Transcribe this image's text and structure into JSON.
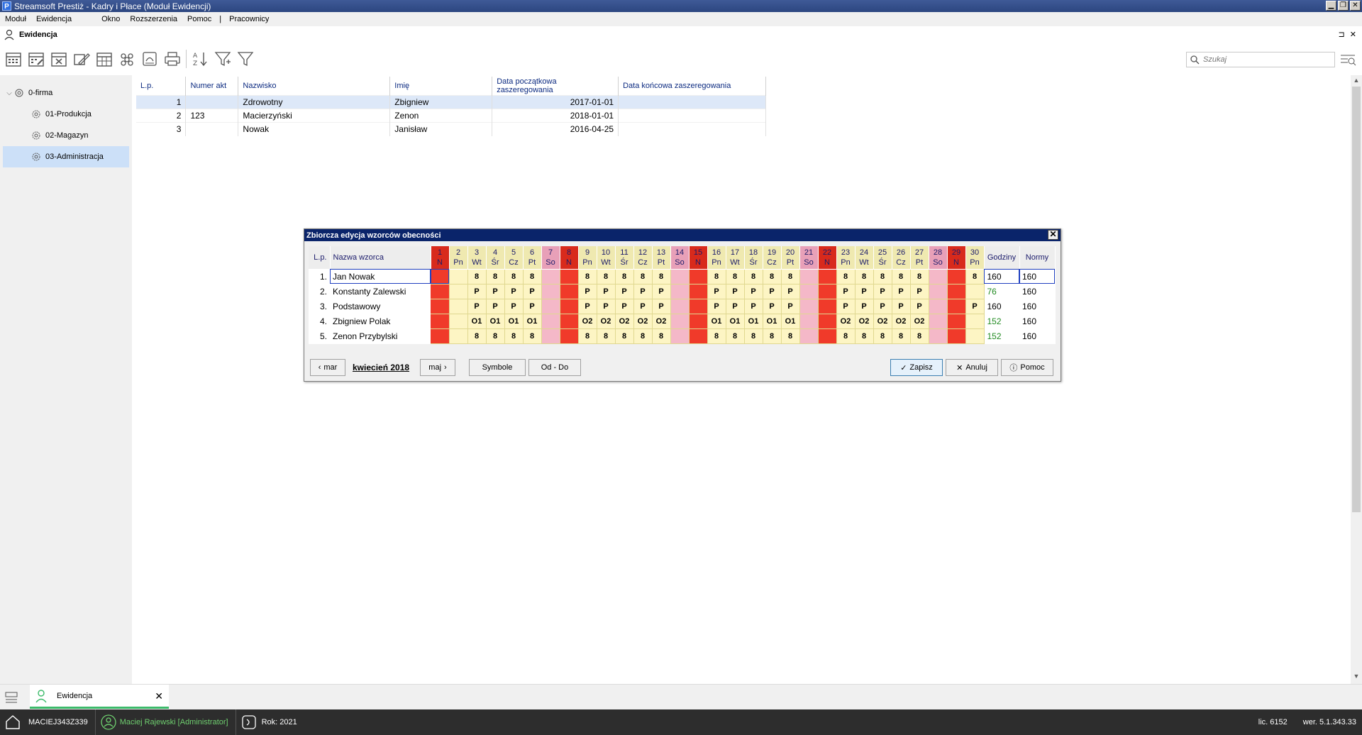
{
  "window": {
    "title": "Streamsoft Prestiż - Kadry i Płace (Moduł Ewidencji)",
    "app_letter": "P"
  },
  "menu": [
    "Moduł",
    "Ewidencja",
    "Okno",
    "Rozszerzenia",
    "Pomoc",
    "|",
    "Pracownicy"
  ],
  "doc_header": {
    "title": "Ewidencja",
    "controls": "⊐ ✕"
  },
  "search": {
    "placeholder": "Szukaj"
  },
  "tree": {
    "root": "0-firma",
    "items": [
      "01-Produkcja",
      "02-Magazyn",
      "03-Administracja"
    ]
  },
  "main_table": {
    "columns": [
      "L.p.",
      "Numer akt",
      "Nazwisko",
      "Imię",
      "Data początkowa zaszeregowania",
      "Data końcowa zaszeregowania"
    ],
    "rows": [
      {
        "lp": "1",
        "numer": "",
        "nazwisko": "Zdrowotny",
        "imie": "Zbigniew",
        "od": "2017-01-01",
        "do": ""
      },
      {
        "lp": "2",
        "numer": "123",
        "nazwisko": "Macierzyński",
        "imie": "Zenon",
        "od": "2018-01-01",
        "do": ""
      },
      {
        "lp": "3",
        "numer": "",
        "nazwisko": "Nowak",
        "imie": "Janisław",
        "od": "2016-04-25",
        "do": ""
      }
    ]
  },
  "dialog": {
    "title": "Zbiorcza edycja wzorców obecności",
    "headers": {
      "lp": "L.p.",
      "name": "Nazwa wzorca",
      "hours": "Godziny",
      "norms": "Normy"
    },
    "days": [
      {
        "n": "1",
        "d": "N"
      },
      {
        "n": "2",
        "d": "Pn"
      },
      {
        "n": "3",
        "d": "Wt"
      },
      {
        "n": "4",
        "d": "Śr"
      },
      {
        "n": "5",
        "d": "Cz"
      },
      {
        "n": "6",
        "d": "Pt"
      },
      {
        "n": "7",
        "d": "So"
      },
      {
        "n": "8",
        "d": "N"
      },
      {
        "n": "9",
        "d": "Pn"
      },
      {
        "n": "10",
        "d": "Wt"
      },
      {
        "n": "11",
        "d": "Śr"
      },
      {
        "n": "12",
        "d": "Cz"
      },
      {
        "n": "13",
        "d": "Pt"
      },
      {
        "n": "14",
        "d": "So"
      },
      {
        "n": "15",
        "d": "N"
      },
      {
        "n": "16",
        "d": "Pn"
      },
      {
        "n": "17",
        "d": "Wt"
      },
      {
        "n": "18",
        "d": "Śr"
      },
      {
        "n": "19",
        "d": "Cz"
      },
      {
        "n": "20",
        "d": "Pt"
      },
      {
        "n": "21",
        "d": "So"
      },
      {
        "n": "22",
        "d": "N"
      },
      {
        "n": "23",
        "d": "Pn"
      },
      {
        "n": "24",
        "d": "Wt"
      },
      {
        "n": "25",
        "d": "Śr"
      },
      {
        "n": "26",
        "d": "Cz"
      },
      {
        "n": "27",
        "d": "Pt"
      },
      {
        "n": "28",
        "d": "So"
      },
      {
        "n": "29",
        "d": "N"
      },
      {
        "n": "30",
        "d": "Pn"
      }
    ],
    "day_types": [
      "sun",
      "work",
      "work",
      "work",
      "work",
      "work",
      "sat",
      "sun",
      "work",
      "work",
      "work",
      "work",
      "work",
      "sat",
      "sun",
      "work",
      "work",
      "work",
      "work",
      "work",
      "sat",
      "sun",
      "work",
      "work",
      "work",
      "work",
      "work",
      "sat",
      "sun",
      "work"
    ],
    "rows": [
      {
        "lp": "1.",
        "name": "Jan Nowak",
        "hours": "160",
        "norms": "160",
        "hours_green": false,
        "cells": [
          "",
          "",
          "8",
          "8",
          "8",
          "8",
          "",
          "",
          "8",
          "8",
          "8",
          "8",
          "8",
          "",
          "",
          "8",
          "8",
          "8",
          "8",
          "8",
          "",
          "",
          "8",
          "8",
          "8",
          "8",
          "8",
          "",
          "",
          "8"
        ]
      },
      {
        "lp": "2.",
        "name": "Konstanty Zalewski",
        "hours": "76",
        "norms": "160",
        "hours_green": true,
        "cells": [
          "",
          "",
          "P",
          "P",
          "P",
          "P",
          "",
          "",
          "P",
          "P",
          "P",
          "P",
          "P",
          "",
          "",
          "P",
          "P",
          "P",
          "P",
          "P",
          "",
          "",
          "P",
          "P",
          "P",
          "P",
          "P",
          "",
          "",
          ""
        ]
      },
      {
        "lp": "3.",
        "name": "Podstawowy",
        "hours": "160",
        "norms": "160",
        "hours_green": false,
        "cells": [
          "",
          "",
          "P",
          "P",
          "P",
          "P",
          "",
          "",
          "P",
          "P",
          "P",
          "P",
          "P",
          "",
          "",
          "P",
          "P",
          "P",
          "P",
          "P",
          "",
          "",
          "P",
          "P",
          "P",
          "P",
          "P",
          "",
          "",
          "P"
        ]
      },
      {
        "lp": "4.",
        "name": "Zbigniew Polak",
        "hours": "152",
        "norms": "160",
        "hours_green": true,
        "cells": [
          "",
          "",
          "O1",
          "O1",
          "O1",
          "O1",
          "",
          "",
          "O2",
          "O2",
          "O2",
          "O2",
          "O2",
          "",
          "",
          "O1",
          "O1",
          "O1",
          "O1",
          "O1",
          "",
          "",
          "O2",
          "O2",
          "O2",
          "O2",
          "O2",
          "",
          "",
          ""
        ]
      },
      {
        "lp": "5.",
        "name": "Zenon Przybylski",
        "hours": "152",
        "norms": "160",
        "hours_green": true,
        "cells": [
          "",
          "",
          "8",
          "8",
          "8",
          "8",
          "",
          "",
          "8",
          "8",
          "8",
          "8",
          "8",
          "",
          "",
          "8",
          "8",
          "8",
          "8",
          "8",
          "",
          "",
          "8",
          "8",
          "8",
          "8",
          "8",
          "",
          "",
          ""
        ]
      }
    ],
    "prev_month": "mar",
    "current_month": "kwiecień 2018",
    "next_month": "maj",
    "btn_symbols": "Symbole",
    "btn_range": "Od - Do",
    "btn_save": "Zapisz",
    "btn_cancel": "Anuluj",
    "btn_help": "Pomoc"
  },
  "bottom_tab": {
    "label": "Ewidencja"
  },
  "status": {
    "computer": "MACIEJ343Z339",
    "user": "Maciej Rajewski [Administrator]",
    "year": "Rok: 2021",
    "licence": "lic. 6152",
    "version": "wer. 5.1.343.33"
  },
  "colors": {
    "sunday": "#f03a2a",
    "saturday": "#f4b8c8",
    "workday": "#fdf5c4",
    "title_bar": "#0a246a"
  }
}
